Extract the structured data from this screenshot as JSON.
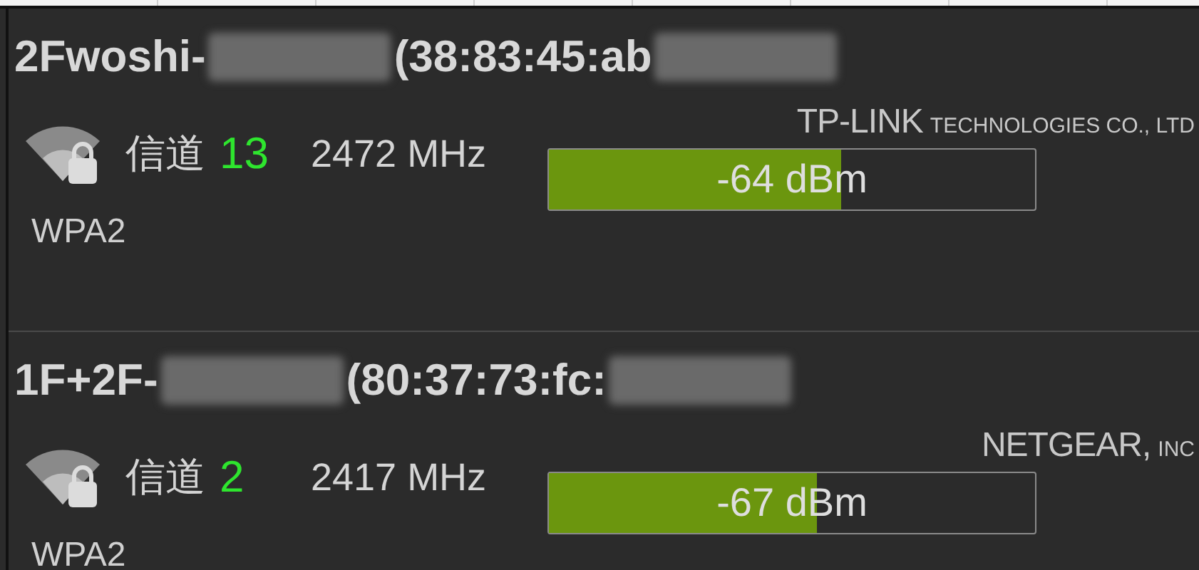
{
  "networks": [
    {
      "ssid": "2Fwoshi-",
      "mac": "(38:83:45:ab",
      "channel_label": "信道",
      "channel": "13",
      "frequency": "2472 MHz",
      "vendor_name": "TP-LINK",
      "vendor_suffix": "TECHNOLOGIES CO., LTD",
      "level": 0.6,
      "reading": "-64 dBm",
      "security": "WPA2"
    },
    {
      "ssid": "1F+2F-",
      "mac": "(80:37:73:fc:",
      "channel_label": "信道",
      "channel": "2",
      "frequency": "2417 MHz",
      "vendor_name": "NETGEAR,",
      "vendor_suffix": "INC",
      "level": 0.55,
      "reading": "-67 dBm",
      "security": "WPA2"
    }
  ]
}
